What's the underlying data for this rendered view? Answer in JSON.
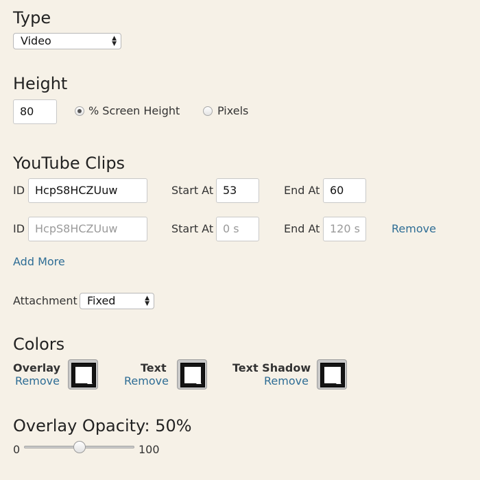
{
  "type_section": {
    "heading": "Type",
    "select_value": "Video"
  },
  "height_section": {
    "heading": "Height",
    "value": "80",
    "options": [
      {
        "label": "% Screen Height",
        "selected": true
      },
      {
        "label": "Pixels",
        "selected": false
      }
    ]
  },
  "clips_section": {
    "heading": "YouTube Clips",
    "id_label": "ID",
    "start_label": "Start At",
    "end_label": "End At",
    "rows": [
      {
        "id_value": "HcpS8HCZUuw",
        "start_value": "53",
        "end_value": "60",
        "remove": ""
      },
      {
        "id_placeholder": "HcpS8HCZUuw",
        "start_placeholder": "0 s",
        "end_placeholder": "120 s",
        "remove": "Remove"
      }
    ],
    "add_more": "Add More"
  },
  "attachment": {
    "label": "Attachment",
    "select_value": "Fixed"
  },
  "colors_section": {
    "heading": "Colors",
    "remove_label": "Remove",
    "items": [
      {
        "label": "Overlay",
        "color": "#141414"
      },
      {
        "label": "Text",
        "color": "#141414"
      },
      {
        "label": "Text Shadow",
        "color": "#141414"
      }
    ]
  },
  "opacity_section": {
    "heading": "Overlay Opacity: 50%",
    "min_label": "0",
    "max_label": "100",
    "value_percent": 50
  },
  "theme": {
    "background": "#f6f1e7",
    "link": "#2e6d95"
  }
}
